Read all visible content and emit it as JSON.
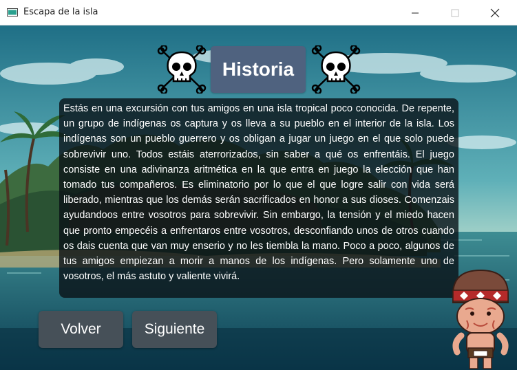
{
  "window": {
    "title": "Escapa de la isla",
    "controls": {
      "minimize_icon": "minimize-icon",
      "maximize_icon": "maximize-icon",
      "close_icon": "close-icon"
    }
  },
  "header": {
    "title": "Historia",
    "decoration_icon": "skull-crossbones-icon"
  },
  "story": {
    "text": "Estás en una excursión con tus amigos en una isla tropical poco conocida. De repente, un grupo de indígenas os captura y os lleva a su pueblo en el interior de la isla. Los indígenas son un pueblo guerrero y os obligan a jugar un juego en el que solo puede sobrevivir uno. Todos estáis aterrorizados, sin saber a qué os enfrentáis. El juego consiste en una adivinanza aritmética en la que entra en juego la elección que han tomado tus compañeros. Es eliminatorio por lo que el que logre salir con vida será liberado, mientras que los demás serán sacrificados en honor a sus dioses. Comenzais ayudandoos entre vosotros para sobrevivir. Sin embargo, la tensión y el miedo hacen que pronto empecéis a enfrentaros entre vosotros, desconfiando unos de otros cuando os dais cuenta que van muy enserio y no les tiembla la mano. Poco a poco, algunos de tus amigos empiezan a morir a manos de los indígenas. Pero solamente uno de vosotros, el más astuto y valiente vivirá."
  },
  "buttons": {
    "back_label": "Volver",
    "next_label": "Siguiente"
  },
  "colors": {
    "title_button": "#4f627f",
    "nav_button": "#465058",
    "text_panel": "#0a1216"
  }
}
